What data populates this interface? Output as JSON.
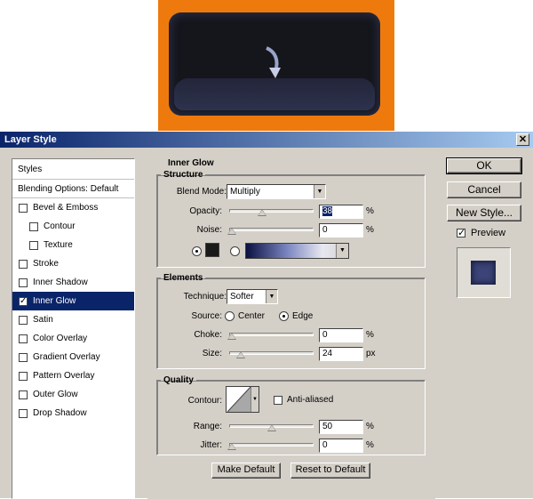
{
  "dialog": {
    "title": "Layer Style",
    "close_glyph": "✕"
  },
  "styles_list": {
    "header": "Styles",
    "blending_options": "Blending Options: Default",
    "items": [
      {
        "label": "Bevel & Emboss",
        "checked": false
      },
      {
        "label": "Contour",
        "checked": false
      },
      {
        "label": "Texture",
        "checked": false
      },
      {
        "label": "Stroke",
        "checked": false
      },
      {
        "label": "Inner Shadow",
        "checked": false
      },
      {
        "label": "Inner Glow",
        "checked": true
      },
      {
        "label": "Satin",
        "checked": false
      },
      {
        "label": "Color Overlay",
        "checked": false
      },
      {
        "label": "Gradient Overlay",
        "checked": false
      },
      {
        "label": "Pattern Overlay",
        "checked": false
      },
      {
        "label": "Outer Glow",
        "checked": false
      },
      {
        "label": "Drop Shadow",
        "checked": false
      }
    ]
  },
  "inner_glow": {
    "title": "Inner Glow",
    "structure": {
      "legend": "Structure",
      "blend_mode_label": "Blend Mode:",
      "blend_mode_value": "Multiply",
      "opacity_label": "Opacity:",
      "opacity_value": "38",
      "opacity_unit": "%",
      "noise_label": "Noise:",
      "noise_value": "0",
      "noise_unit": "%",
      "color_swatch": "#1a1a1a"
    },
    "elements": {
      "legend": "Elements",
      "technique_label": "Technique:",
      "technique_value": "Softer",
      "source_label": "Source:",
      "source_center": "Center",
      "source_edge": "Edge",
      "choke_label": "Choke:",
      "choke_value": "0",
      "choke_unit": "%",
      "size_label": "Size:",
      "size_value": "24",
      "size_unit": "px"
    },
    "quality": {
      "legend": "Quality",
      "contour_label": "Contour:",
      "anti_aliased_label": "Anti-aliased",
      "range_label": "Range:",
      "range_value": "50",
      "range_unit": "%",
      "jitter_label": "Jitter:",
      "jitter_value": "0",
      "jitter_unit": "%"
    },
    "make_default": "Make Default",
    "reset_to_default": "Reset to Default"
  },
  "right_buttons": {
    "ok": "OK",
    "cancel": "Cancel",
    "new_style": "New Style...",
    "preview_label": "Preview"
  },
  "colors": {
    "canvas_orange": "#ee7a0e",
    "selection_blue": "#0a246a"
  }
}
